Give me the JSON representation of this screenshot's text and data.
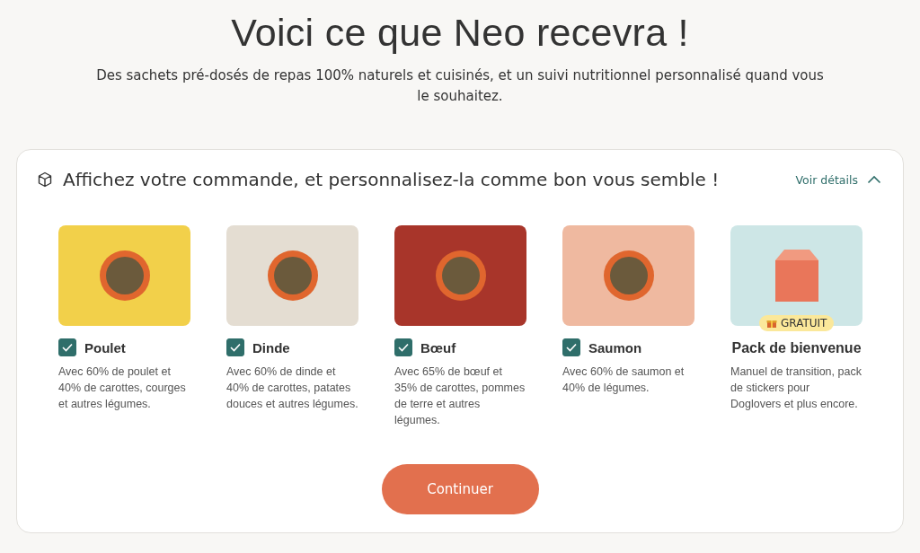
{
  "heading": "Voici ce que Neo recevra !",
  "subtitle": "Des sachets pré-dosés de repas 100% naturels et cuisinés, et un suivi nutritionnel personnalisé quand vous le souhaitez.",
  "order_card": {
    "title": "Affichez votre commande, et personnalisez-la comme bon vous semble !",
    "details_link": "Voir détails",
    "expanded": true,
    "items": [
      {
        "kind": "recipe",
        "name": "Poulet",
        "checked": true,
        "description": "Avec 60% de poulet et 40% de carottes, courges et autres légumes.",
        "color": "#f2d04a"
      },
      {
        "kind": "recipe",
        "name": "Dinde",
        "checked": true,
        "description": "Avec 60% de dinde et 40% de carottes, patates douces et autres légumes.",
        "color": "#e4ddd2"
      },
      {
        "kind": "recipe",
        "name": "Bœuf",
        "checked": true,
        "description": "Avec 65% de bœuf et 35% de carottes, pommes de terre et autres légumes.",
        "color": "#a8352a"
      },
      {
        "kind": "recipe",
        "name": "Saumon",
        "checked": true,
        "description": "Avec 60% de saumon et 40% de légumes.",
        "color": "#efb9a0"
      },
      {
        "kind": "gift",
        "name": "Pack de bienvenue",
        "badge": "GRATUIT",
        "description": "Manuel de transition, pack de stickers pour Doglovers et plus encore.",
        "color": "#cde6e6"
      }
    ],
    "button": "Continuer"
  }
}
